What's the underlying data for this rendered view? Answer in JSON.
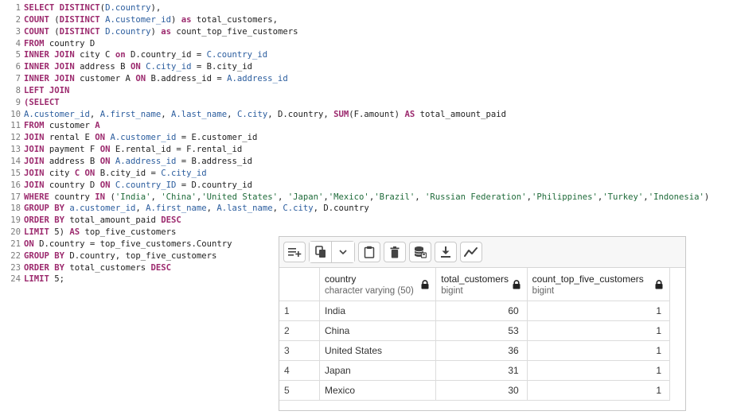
{
  "editor": {
    "lines": [
      [
        [
          "kw",
          "SELECT DISTINCT"
        ],
        [
          "",
          "("
        ],
        [
          "id",
          "D.country"
        ],
        [
          "",
          "),"
        ]
      ],
      [
        [
          "kw",
          "COUNT"
        ],
        [
          "",
          " ("
        ],
        [
          "kw",
          "DISTINCT"
        ],
        [
          "",
          " "
        ],
        [
          "id",
          "A.customer_id"
        ],
        [
          "",
          ") "
        ],
        [
          "kw",
          "as"
        ],
        [
          "",
          " total_customers,"
        ]
      ],
      [
        [
          "kw",
          "COUNT"
        ],
        [
          "",
          " ("
        ],
        [
          "kw",
          "DISTINCT"
        ],
        [
          "",
          " "
        ],
        [
          "id",
          "D.country"
        ],
        [
          "",
          ") "
        ],
        [
          "kw",
          "as"
        ],
        [
          "",
          " count_top_five_customers"
        ]
      ],
      [
        [
          "kw",
          "FROM"
        ],
        [
          "",
          " country D"
        ]
      ],
      [
        [
          "kw",
          "INNER JOIN"
        ],
        [
          "",
          " city C "
        ],
        [
          "kw",
          "on"
        ],
        [
          "",
          " D.country_id = "
        ],
        [
          "id",
          "C.country_id"
        ]
      ],
      [
        [
          "kw",
          "INNER JOIN"
        ],
        [
          "",
          " address B "
        ],
        [
          "kw",
          "ON"
        ],
        [
          "",
          " "
        ],
        [
          "id",
          "C.city_id"
        ],
        [
          "",
          " = B.city_id"
        ]
      ],
      [
        [
          "kw",
          "INNER JOIN"
        ],
        [
          "",
          " customer A "
        ],
        [
          "kw",
          "ON"
        ],
        [
          "",
          " B.address_id = "
        ],
        [
          "id",
          "A.address_id"
        ]
      ],
      [
        [
          "kw",
          "LEFT JOIN"
        ]
      ],
      [
        [
          "kw",
          "(SELECT"
        ]
      ],
      [
        [
          "id",
          "A.customer_id"
        ],
        [
          "",
          ", "
        ],
        [
          "id",
          "A.first_name"
        ],
        [
          "",
          ", "
        ],
        [
          "id",
          "A.last_name"
        ],
        [
          "",
          ", "
        ],
        [
          "id",
          "C.city"
        ],
        [
          "",
          ", D.country, "
        ],
        [
          "fn",
          "SUM"
        ],
        [
          "",
          "(F.amount) "
        ],
        [
          "kw",
          "AS"
        ],
        [
          "",
          " total_amount_paid"
        ]
      ],
      [
        [
          "kw",
          "FROM"
        ],
        [
          "",
          " customer "
        ],
        [
          "kw",
          "A"
        ]
      ],
      [
        [
          "kw",
          "JOIN"
        ],
        [
          "",
          " rental E "
        ],
        [
          "kw",
          "ON"
        ],
        [
          "",
          " "
        ],
        [
          "id",
          "A.customer_id"
        ],
        [
          "",
          " = E.customer_id"
        ]
      ],
      [
        [
          "kw",
          "JOIN"
        ],
        [
          "",
          " payment F "
        ],
        [
          "kw",
          "ON"
        ],
        [
          "",
          " E.rental_id = F.rental_id"
        ]
      ],
      [
        [
          "kw",
          "JOIN"
        ],
        [
          "",
          " address B "
        ],
        [
          "kw",
          "ON"
        ],
        [
          "",
          " "
        ],
        [
          "id",
          "A.address_id"
        ],
        [
          "",
          " = B.address_id"
        ]
      ],
      [
        [
          "kw",
          "JOIN"
        ],
        [
          "",
          " city "
        ],
        [
          "kw",
          "C ON"
        ],
        [
          "",
          " B.city_id = "
        ],
        [
          "id",
          "C.city_id"
        ]
      ],
      [
        [
          "kw",
          "JOIN"
        ],
        [
          "",
          " country D "
        ],
        [
          "kw",
          "ON"
        ],
        [
          "",
          " "
        ],
        [
          "id",
          "C.country_ID"
        ],
        [
          "",
          " = D.country_id"
        ]
      ],
      [
        [
          "kw",
          "WHERE"
        ],
        [
          "",
          " country "
        ],
        [
          "kw",
          "IN"
        ],
        [
          "",
          " ("
        ],
        [
          "str",
          "'India'"
        ],
        [
          "",
          ", "
        ],
        [
          "str",
          "'China'"
        ],
        [
          "",
          ","
        ],
        [
          "str",
          "'United States'"
        ],
        [
          "",
          ", "
        ],
        [
          "str",
          "'Japan'"
        ],
        [
          "",
          ","
        ],
        [
          "str",
          "'Mexico'"
        ],
        [
          "",
          ","
        ],
        [
          "str",
          "'Brazil'"
        ],
        [
          "",
          ", "
        ],
        [
          "str",
          "'Russian Federation'"
        ],
        [
          "",
          ","
        ],
        [
          "str",
          "'Philippines'"
        ],
        [
          "",
          ","
        ],
        [
          "str",
          "'Turkey'"
        ],
        [
          "",
          ","
        ],
        [
          "str",
          "'Indonesia'"
        ],
        [
          "",
          ")"
        ]
      ],
      [
        [
          "kw",
          "GROUP BY"
        ],
        [
          "",
          " "
        ],
        [
          "id",
          "a.customer_id"
        ],
        [
          "",
          ", "
        ],
        [
          "id",
          "A.first_name"
        ],
        [
          "",
          ", "
        ],
        [
          "id",
          "A.last_name"
        ],
        [
          "",
          ", "
        ],
        [
          "id",
          "C.city"
        ],
        [
          "",
          ", D.country"
        ]
      ],
      [
        [
          "kw",
          "ORDER BY"
        ],
        [
          "",
          " total_amount_paid "
        ],
        [
          "kw",
          "DESC"
        ]
      ],
      [
        [
          "kw",
          "LIMIT"
        ],
        [
          "",
          " 5) "
        ],
        [
          "kw",
          "AS"
        ],
        [
          "",
          " top_five_customers"
        ]
      ],
      [
        [
          "kw",
          "ON"
        ],
        [
          "",
          " D.country = top_five_customers.Country"
        ]
      ],
      [
        [
          "kw",
          "GROUP BY"
        ],
        [
          "",
          " D.country, top_five_customers"
        ]
      ],
      [
        [
          "kw",
          "ORDER BY"
        ],
        [
          "",
          " total_customers "
        ],
        [
          "kw",
          "DESC"
        ]
      ],
      [
        [
          "kw",
          "LIMIT"
        ],
        [
          "",
          " 5;"
        ]
      ]
    ]
  },
  "toolbar": {
    "buttons": [
      {
        "name": "add-row-icon"
      },
      {
        "name": "copy-icon"
      },
      {
        "name": "chevron-down-icon"
      },
      {
        "name": "paste-icon"
      },
      {
        "name": "delete-icon"
      },
      {
        "name": "save-data-icon"
      },
      {
        "name": "download-icon"
      },
      {
        "name": "graph-icon"
      }
    ]
  },
  "results": {
    "columns": [
      {
        "name": "country",
        "type": "character varying (50)",
        "numeric": false
      },
      {
        "name": "total_customers",
        "type": "bigint",
        "numeric": true
      },
      {
        "name": "count_top_five_customers",
        "type": "bigint",
        "numeric": true
      }
    ],
    "rows": [
      {
        "n": "1",
        "cells": [
          "India",
          "60",
          "1"
        ]
      },
      {
        "n": "2",
        "cells": [
          "China",
          "53",
          "1"
        ]
      },
      {
        "n": "3",
        "cells": [
          "United States",
          "36",
          "1"
        ]
      },
      {
        "n": "4",
        "cells": [
          "Japan",
          "31",
          "1"
        ]
      },
      {
        "n": "5",
        "cells": [
          "Mexico",
          "30",
          "1"
        ]
      }
    ]
  },
  "colors": {
    "keyword": "#9c2a6e",
    "identifier": "#2b5d9e",
    "string": "#1f6b3a",
    "line_number": "#7a7a7a"
  }
}
